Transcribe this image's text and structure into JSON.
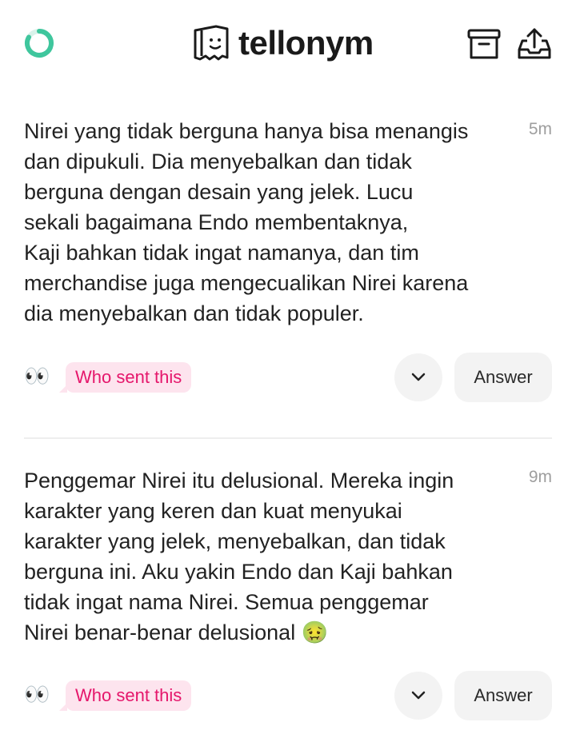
{
  "header": {
    "brand": "tellonym",
    "left_icon": "progress-ring-icon",
    "right_icons": [
      "archive-icon",
      "share-icon"
    ]
  },
  "colors": {
    "accent_green": "#3fc69d",
    "who_bg": "#fde4ee",
    "who_text": "#e5166b",
    "button_bg": "#f3f3f3"
  },
  "tells": [
    {
      "text": "Nirei yang tidak berguna hanya bisa menangis\ndan dipukuli. Dia menyebalkan dan tidak\nberguna dengan desain yang jelek. Lucu\nsekali bagaimana Endo membentaknya,\nKaji bahkan tidak ingat namanya, dan tim\nmerchandise juga mengecualikan Nirei karena\ndia menyebalkan dan tidak populer.",
      "time": "5m",
      "emoji": "👀",
      "who_label": "Who sent this",
      "answer_label": "Answer"
    },
    {
      "text": "Penggemar Nirei itu delusional. Mereka ingin\nkarakter yang keren dan kuat menyukai\nkarakter yang jelek, menyebalkan, dan tidak\nberguna ini. Aku yakin Endo dan Kaji bahkan\ntidak ingat nama Nirei. Semua penggemar\nNirei benar-benar delusional 🤢",
      "time": "9m",
      "emoji": "👀",
      "who_label": "Who sent this",
      "answer_label": "Answer"
    }
  ]
}
